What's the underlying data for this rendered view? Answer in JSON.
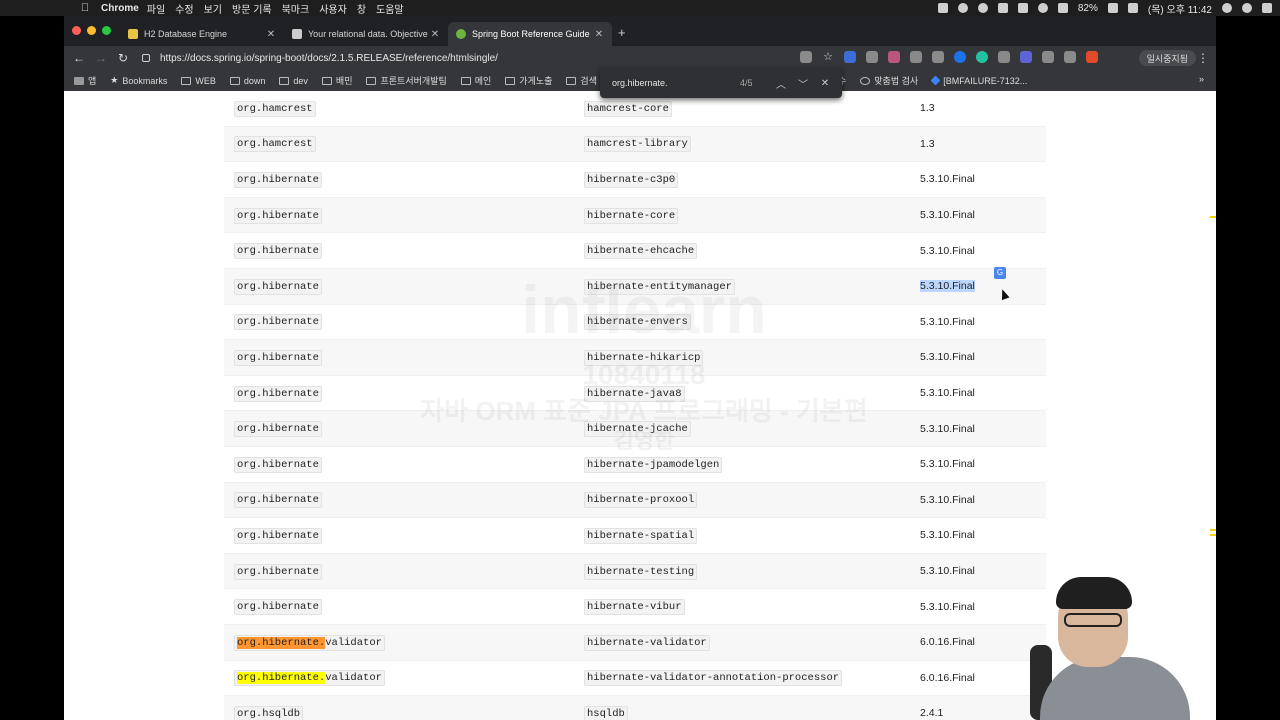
{
  "menubar": {
    "app_name": "Chrome",
    "items": [
      "파일",
      "수정",
      "보기",
      "방문 기록",
      "북마크",
      "사용자",
      "창",
      "도움말"
    ],
    "battery": "82%",
    "clock": "(목) 오후 11:42"
  },
  "tabs": [
    {
      "title": "H2 Database Engine",
      "color": "#e8c547"
    },
    {
      "title": "Your relational data. Objective",
      "color": "#cccccc"
    },
    {
      "title": "Spring Boot Reference Guide",
      "color": "#6db33f"
    }
  ],
  "omnibox": {
    "url": "https://docs.spring.io/spring-boot/docs/2.1.5.RELEASE/reference/htmlsingle/"
  },
  "profile_label": "일시중지됨",
  "bookmarks": [
    "앱",
    "Bookmarks",
    "WEB",
    "down",
    "dev",
    "배민",
    "프론트서버개발팀",
    "메인",
    "가게노출",
    "검색"
  ],
  "bookmarks_right": [
    "수",
    "맞춤법 검사",
    "[BMFAILURE-7132..."
  ],
  "find": {
    "query": "org.hibernate.",
    "count": "4/5"
  },
  "rows": [
    {
      "group": "org.hamcrest",
      "artifact": "hamcrest-core",
      "version": "1.3"
    },
    {
      "group": "org.hamcrest",
      "artifact": "hamcrest-library",
      "version": "1.3"
    },
    {
      "group": "org.hibernate",
      "artifact": "hibernate-c3p0",
      "version": "5.3.10.Final"
    },
    {
      "group": "org.hibernate",
      "artifact": "hibernate-core",
      "version": "5.3.10.Final"
    },
    {
      "group": "org.hibernate",
      "artifact": "hibernate-ehcache",
      "version": "5.3.10.Final"
    },
    {
      "group": "org.hibernate",
      "artifact": "hibernate-entitymanager",
      "version": "5.3.10.Final"
    },
    {
      "group": "org.hibernate",
      "artifact": "hibernate-envers",
      "version": "5.3.10.Final"
    },
    {
      "group": "org.hibernate",
      "artifact": "hibernate-hikaricp",
      "version": "5.3.10.Final"
    },
    {
      "group": "org.hibernate",
      "artifact": "hibernate-java8",
      "version": "5.3.10.Final"
    },
    {
      "group": "org.hibernate",
      "artifact": "hibernate-jcache",
      "version": "5.3.10.Final"
    },
    {
      "group": "org.hibernate",
      "artifact": "hibernate-jpamodelgen",
      "version": "5.3.10.Final"
    },
    {
      "group": "org.hibernate",
      "artifact": "hibernate-proxool",
      "version": "5.3.10.Final"
    },
    {
      "group": "org.hibernate",
      "artifact": "hibernate-spatial",
      "version": "5.3.10.Final"
    },
    {
      "group": "org.hibernate",
      "artifact": "hibernate-testing",
      "version": "5.3.10.Final"
    },
    {
      "group": "org.hibernate",
      "artifact": "hibernate-vibur",
      "version": "5.3.10.Final"
    },
    {
      "group_match": "org.hibernate.",
      "group_rest": "validator",
      "artifact": "hibernate-validator",
      "version": "6.0.16.Final"
    },
    {
      "group_match": "org.hibernate.",
      "group_rest": "validator",
      "artifact": "hibernate-validator-annotation-processor",
      "version": "6.0.16.Final"
    },
    {
      "group": "org.hsqldb",
      "artifact": "hsqldb",
      "version": "2.4.1"
    }
  ],
  "watermark": {
    "logo": "inflearn",
    "id": "10840118",
    "course": "자바 ORM 표준 JPA 프로그래밍 - 기본편",
    "name": "김영한"
  },
  "colors": {
    "find_current": "#ff9632",
    "find_match": "#ffff00",
    "selection": "#bcd6ff"
  }
}
